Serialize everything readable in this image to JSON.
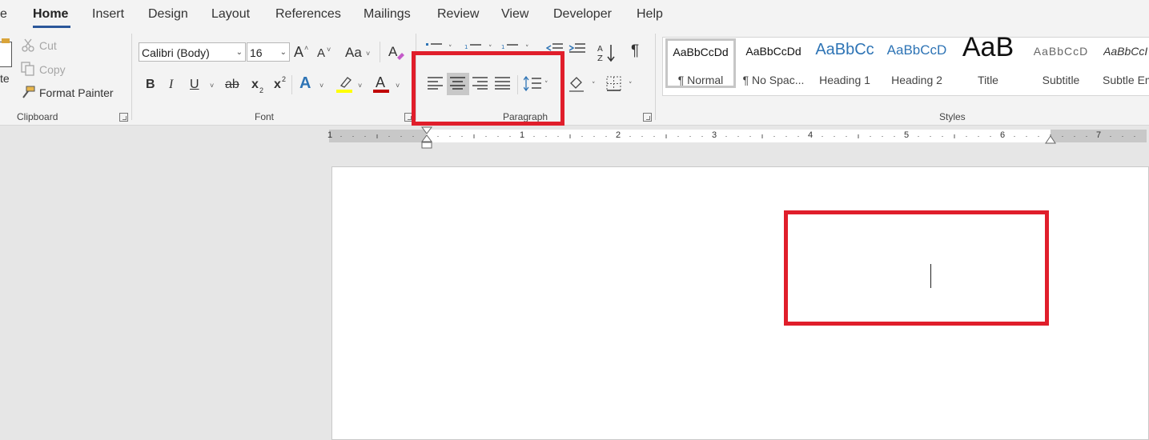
{
  "tabs": [
    {
      "label": "e",
      "active": false
    },
    {
      "label": "Home",
      "active": true
    },
    {
      "label": "Insert",
      "active": false
    },
    {
      "label": "Design",
      "active": false
    },
    {
      "label": "Layout",
      "active": false
    },
    {
      "label": "References",
      "active": false
    },
    {
      "label": "Mailings",
      "active": false
    },
    {
      "label": "Review",
      "active": false
    },
    {
      "label": "View",
      "active": false
    },
    {
      "label": "Developer",
      "active": false
    },
    {
      "label": "Help",
      "active": false
    }
  ],
  "clipboard": {
    "paste_label": "te",
    "cut_label": "Cut",
    "copy_label": "Copy",
    "format_painter_label": "Format Painter",
    "group_label": "Clipboard"
  },
  "font": {
    "family": "Calibri (Body)",
    "size": "16",
    "bold": "B",
    "italic": "I",
    "underline": "U",
    "strikethrough": "ab",
    "subscript": "x",
    "superscript": "x",
    "change_case": "Aa",
    "grow": "A",
    "shrink": "A",
    "text_effects": "A",
    "font_color": "A",
    "group_label": "Font"
  },
  "paragraph": {
    "group_label": "Paragraph",
    "pilcrow": "¶"
  },
  "styles": {
    "group_label": "Styles",
    "items": [
      {
        "preview": "AaBbCcDd",
        "name": "¶ Normal"
      },
      {
        "preview": "AaBbCcDd",
        "name": "¶ No Spac..."
      },
      {
        "preview": "AaBbCc",
        "name": "Heading 1"
      },
      {
        "preview": "AaBbCcD",
        "name": "Heading 2"
      },
      {
        "preview": "AaB",
        "name": "Title"
      },
      {
        "preview": "AaBbCcD",
        "name": "Subtitle"
      },
      {
        "preview": "AaBbCcI",
        "name": "Subtle Em"
      }
    ]
  },
  "ruler": {
    "numbers": [
      "1",
      "1",
      "2",
      "3",
      "4",
      "5",
      "6",
      "7"
    ]
  },
  "colors": {
    "accent": "#2b579a",
    "highlight_box": "#e01e2b",
    "font_color_bar": "#c00000",
    "highlight_bar": "#ffff00"
  }
}
